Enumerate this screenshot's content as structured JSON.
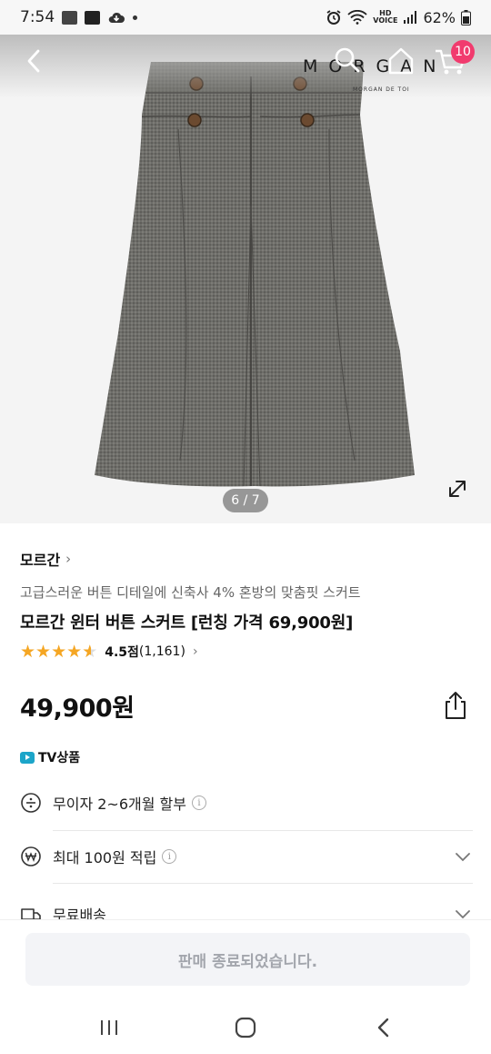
{
  "status_bar": {
    "time": "7:54",
    "battery": "62%",
    "hd_top": "HD",
    "hd_bottom": "VOICE"
  },
  "header": {
    "brand_logo": "MORGAN",
    "brand_logo_sub": "MORGAN DE TOI",
    "cart_count": "10"
  },
  "gallery": {
    "pager": "6 / 7"
  },
  "product": {
    "brand": "모르간",
    "subtitle": "고급스러운 버튼 디테일에 신축사 4% 혼방의 맞춤핏 스커트",
    "title": "모르간 윈터 버튼 스커트 [런칭 가격 69,900원]",
    "rating_value": 4.5,
    "rating_score_label": "4.5점",
    "rating_count": "(1,161)",
    "price": "49,900원",
    "tv_label": "TV상품"
  },
  "benefits": [
    {
      "label": "무이자 2~6개월 할부",
      "icon": "installment-icon",
      "has_info": true,
      "expandable": false
    },
    {
      "label": "최대 100원 적립",
      "icon": "won-coin-icon",
      "has_info": true,
      "expandable": true
    },
    {
      "label": "무료배송",
      "icon": "truck-icon",
      "has_info": false,
      "expandable": true
    }
  ],
  "bottom": {
    "sold_out_label": "판매 종료되었습니다."
  },
  "colors": {
    "accent_pink": "#f13b6e",
    "star": "#f5a623",
    "tv_blue": "#1ca5c9",
    "disabled_bg": "#f3f4f7",
    "disabled_text": "#a3a6ad"
  }
}
